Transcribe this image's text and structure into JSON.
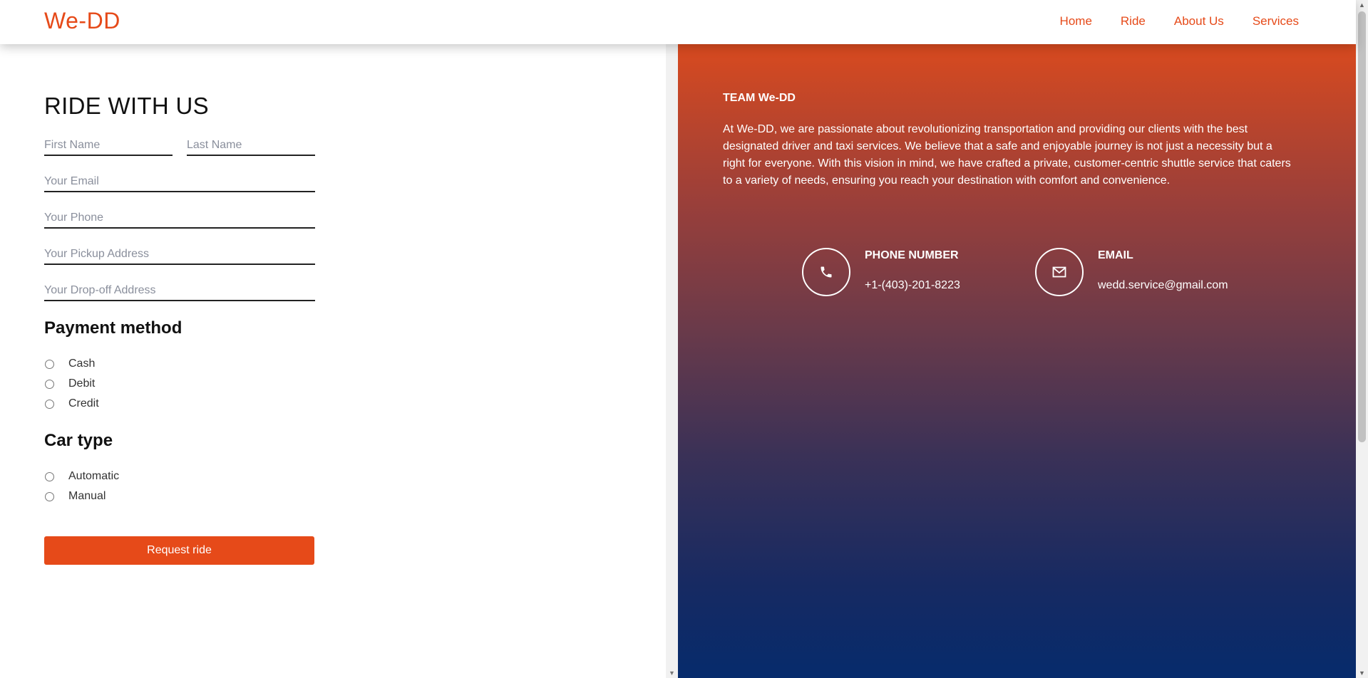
{
  "header": {
    "logo": "We-DD",
    "nav": [
      "Home",
      "Ride",
      "About Us",
      "Services"
    ]
  },
  "form": {
    "title": "RIDE WITH US",
    "placeholders": {
      "first_name": "First Name",
      "last_name": "Last Name",
      "email": "Your Email",
      "phone": "Your Phone",
      "pickup": "Your Pickup Address",
      "dropoff": "Your Drop-off Address"
    },
    "payment_title": "Payment method",
    "payment_options": [
      "Cash",
      "Debit",
      "Credit"
    ],
    "car_title": "Car type",
    "car_options": [
      "Automatic",
      "Manual"
    ],
    "submit_label": "Request ride"
  },
  "panel": {
    "team_title": "TEAM We-DD",
    "description": "At We-DD, we are passionate about revolutionizing transportation and providing our clients with the best designated driver and taxi services. We believe that a safe and enjoyable journey is not just a necessity but a right for everyone. With this vision in mind, we have crafted a private, customer-centric shuttle service that caters to a variety of needs, ensuring you reach your destination with comfort and convenience.",
    "phone_label": "PHONE NUMBER",
    "phone_value": "+1-(403)-201-8223",
    "email_label": "EMAIL",
    "email_value": "wedd.service@gmail.com",
    "phone_icon": "phone-icon",
    "email_icon": "envelope-icon"
  },
  "colors": {
    "accent": "#e64a19",
    "gradient_top": "#d84a1f",
    "gradient_bottom": "#062b6c"
  }
}
